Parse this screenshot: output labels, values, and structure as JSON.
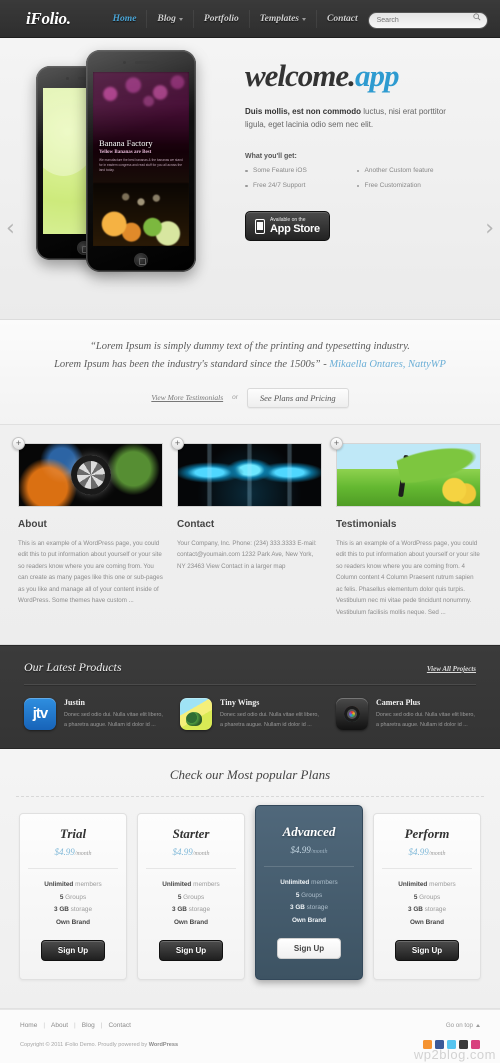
{
  "header": {
    "logo": "iFolio.",
    "nav": [
      {
        "label": "Home",
        "active": true,
        "caret": false
      },
      {
        "label": "Blog",
        "active": false,
        "caret": true
      },
      {
        "label": "Portfolio",
        "active": false,
        "caret": false
      },
      {
        "label": "Templates",
        "active": false,
        "caret": true
      },
      {
        "label": "Contact",
        "active": false,
        "caret": false
      }
    ],
    "search_placeholder": "Search",
    "accent_color": "#4aa6d8"
  },
  "hero": {
    "title_main": "welcome.",
    "title_accent": "app",
    "description_bold": "Duis mollis, est non commodo",
    "description_rest": " luctus, nisi erat porttitor ligula, eget lacinia odio sem nec elit.",
    "what_label": "What you'll get:",
    "features_left": [
      "Some Feature iOS",
      "Free 24/7 Support"
    ],
    "features_right": [
      "Another Custom feature",
      "Free Customization"
    ],
    "appstore_small": "Available on the",
    "appstore_big": "App Store",
    "prev_arrow": "‹",
    "next_arrow": "›",
    "phone_app_title": "Banana Factory",
    "phone_app_subtitle": "Yellow Bananas are Best",
    "phone_app_body": "We manufacture the best bananas & the bananas we stand for in eastern congress and read stuff for you all across the land today."
  },
  "quote": {
    "line1": "“Lorem Ipsum is simply dummy text of the printing and typesetting industry.",
    "line2": "Lorem Ipsum has been the industry's standard since the 1500s” - ",
    "author": "Mikaella Ontares, NattyWP",
    "link_testimonials": "View More Testimonials",
    "or": "or",
    "btn_plans": "See Plans and Pricing"
  },
  "columns": [
    {
      "title": "About",
      "badge": "+",
      "art": "art-wheel",
      "text": "This is an example of a WordPress page, you could edit this to put information about yourself or your site so readers know where you are coming from. You can create as many pages like this one or sub-pages as you like and manage all of your content inside of WordPress. Some themes have custom ..."
    },
    {
      "title": "Contact",
      "badge": "+",
      "art": "art-bulbs",
      "text": "Your Company, Inc. Phone: (234) 333.3333 E-mail: contact@youmain.com 1232 Park Ave, New York, NY 23463 View Contact in a larger map"
    },
    {
      "title": "Testimonials",
      "badge": "+",
      "art": "art-field",
      "text": "This is an example of a WordPress page, you could edit this to put information about yourself or your site so readers know where you are coming from. 4 Column content 4 Column Praesent rutrum sapien ac felis. Phasellus elementum dolor quis turpis. Vestibulum nec mi vitae pede tincidunt nonummy. Vestibulum facilisis mollis neque. Sed ..."
    }
  ],
  "products": {
    "title": "Our Latest Products",
    "view_all": "View All Projects",
    "items": [
      {
        "name": "Justin",
        "icon": "ic-jtv",
        "text": "Donec sed odio dui. Nulla vitae elit libero, a pharetra augue. Nullam id dolor id ..."
      },
      {
        "name": "Tiny Wings",
        "icon": "ic-wings",
        "text": "Donec sed odio dui. Nulla vitae elit libero, a pharetra augue. Nullam id dolor id ..."
      },
      {
        "name": "Camera Plus",
        "icon": "ic-camera",
        "text": "Donec sed odio dui. Nulla vitae elit libero, a pharetra augue. Nullam id dolor id ..."
      }
    ]
  },
  "plans": {
    "title": "Check our Most popular Plans",
    "items": [
      {
        "name": "Trial",
        "price": "$4.99",
        "per": "/month",
        "featured": false,
        "features": [
          {
            "b": "Unlimited",
            "t": " members"
          },
          {
            "b": "5",
            "t": " Groups"
          },
          {
            "b": "3 GB",
            "t": " storage"
          },
          {
            "b": "Own Brand",
            "t": ""
          }
        ],
        "cta": "Sign Up"
      },
      {
        "name": "Starter",
        "price": "$4.99",
        "per": "/month",
        "featured": false,
        "features": [
          {
            "b": "Unlimited",
            "t": " members"
          },
          {
            "b": "5",
            "t": " Groups"
          },
          {
            "b": "3 GB",
            "t": " storage"
          },
          {
            "b": "Own Brand",
            "t": ""
          }
        ],
        "cta": "Sign Up"
      },
      {
        "name": "Advanced",
        "price": "$4.99",
        "per": "/month",
        "featured": true,
        "features": [
          {
            "b": "Unlimited",
            "t": " members"
          },
          {
            "b": "5",
            "t": " Groups"
          },
          {
            "b": "3 GB",
            "t": " storage"
          },
          {
            "b": "Own Brand",
            "t": ""
          }
        ],
        "cta": "Sign Up"
      },
      {
        "name": "Perform",
        "price": "$4.99",
        "per": "/month",
        "featured": false,
        "features": [
          {
            "b": "Unlimited",
            "t": " members"
          },
          {
            "b": "5",
            "t": " Groups"
          },
          {
            "b": "3 GB",
            "t": " storage"
          },
          {
            "b": "Own Brand",
            "t": ""
          }
        ],
        "cta": "Sign Up"
      }
    ],
    "featured_color": "#466073"
  },
  "footer": {
    "links": [
      "Home",
      "About",
      "Blog",
      "Contact"
    ],
    "separator": "|",
    "go_top": "Go on top",
    "copyright_plain": "Copyright © 2011 iFolio Demo. Proudly powered by ",
    "copyright_bold": "WordPress",
    "socials": [
      "rss-icon",
      "facebook-icon",
      "twitter-icon",
      "flickr-icon",
      "instagram-icon"
    ],
    "watermark": "wp2blog.com"
  }
}
